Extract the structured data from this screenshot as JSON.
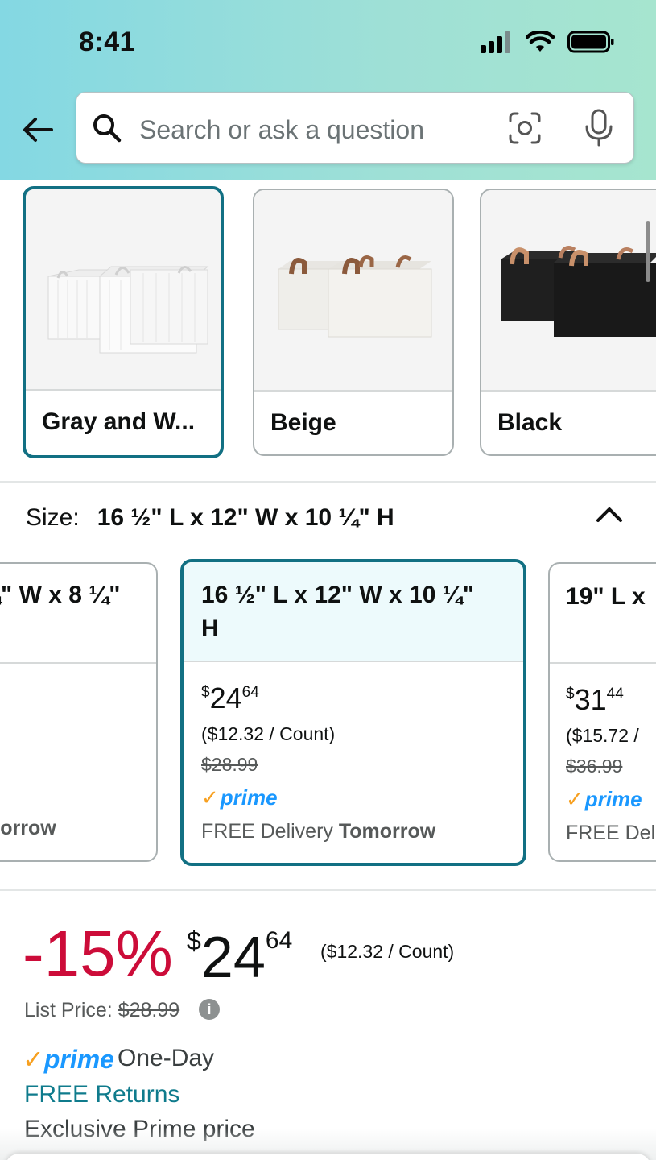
{
  "status_bar": {
    "time": "8:41"
  },
  "search": {
    "placeholder": "Search or ask a question"
  },
  "colors": [
    {
      "label": "Gray and W...",
      "selected": true
    },
    {
      "label": "Beige",
      "selected": false
    },
    {
      "label": "Black",
      "selected": false
    }
  ],
  "size": {
    "label": "Size:",
    "value": "16 ½\" L x 12\" W x 10 ¼\" H"
  },
  "size_options": [
    {
      "title_line1": "¼\" W x 8 ¼\"",
      "delivery_tail": "morrow"
    },
    {
      "title_line1": "16 ½\" L x 12\" W x 10 ¼\"",
      "title_line2": "H",
      "price_dollars": "24",
      "price_cents": "64",
      "unit_price": "($12.32 / Count)",
      "list_price": "$28.99",
      "prime": "prime",
      "delivery_prefix": "FREE Delivery",
      "delivery_day": "Tomorrow"
    },
    {
      "title_line1": "19\" L x",
      "price_dollars": "31",
      "price_cents": "44",
      "unit_price": "($15.72 /",
      "list_price": "$36.99",
      "prime": "prime",
      "delivery_prefix": "FREE Deli"
    }
  ],
  "buybox": {
    "discount": "-15%",
    "currency": "$",
    "price_whole": "24",
    "price_fraction": "64",
    "unit_price": "($12.32 / Count)",
    "list_price_label": "List Price:",
    "list_price": "$28.99",
    "prime": "prime",
    "delivery_speed": "One-Day",
    "free_returns": "FREE Returns",
    "exclusive": "Exclusive Prime price"
  },
  "accent_colors": {
    "teal": "#127083",
    "discount_red": "#cc0c39",
    "prime_blue": "#1a98ff",
    "prime_check": "#f7a020"
  }
}
